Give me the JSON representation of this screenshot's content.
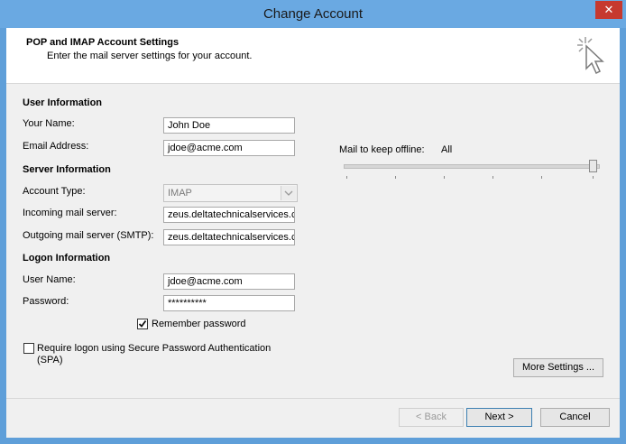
{
  "window": {
    "title": "Change Account",
    "close_label": "✕"
  },
  "header": {
    "title": "POP and IMAP Account Settings",
    "subtitle": "Enter the mail server settings for your account."
  },
  "user_info": {
    "section": "User Information",
    "name_label": "Your Name:",
    "name_value": "John Doe",
    "email_label": "Email Address:",
    "email_value": "jdoe@acme.com"
  },
  "server_info": {
    "section": "Server Information",
    "account_type_label": "Account Type:",
    "account_type_value": "IMAP",
    "incoming_label": "Incoming mail server:",
    "incoming_value": "zeus.deltatechnicalservices.c",
    "outgoing_label": "Outgoing mail server (SMTP):",
    "outgoing_value": "zeus.deltatechnicalservices.c"
  },
  "logon_info": {
    "section": "Logon Information",
    "username_label": "User Name:",
    "username_value": "jdoe@acme.com",
    "password_label": "Password:",
    "password_value": "**********",
    "remember_label": "Remember password",
    "remember_checked": true,
    "spa_label_line1": "Require logon using Secure Password Authentication",
    "spa_label_line2": "(SPA)",
    "spa_checked": false
  },
  "offline": {
    "label": "Mail to keep offline:",
    "value": "All",
    "slider_fraction": 1.0
  },
  "buttons": {
    "more_settings": "More Settings ...",
    "back": "< Back",
    "next": "Next >",
    "cancel": "Cancel"
  }
}
